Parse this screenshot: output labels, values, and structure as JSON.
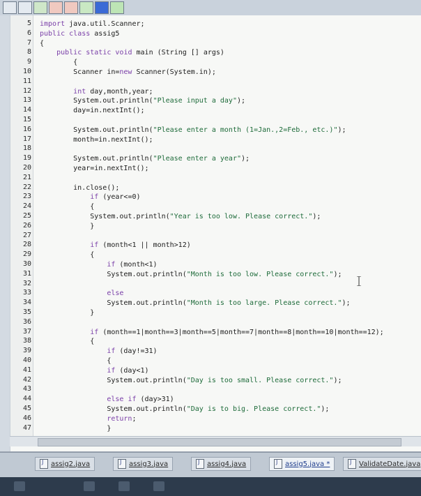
{
  "toolbar": {
    "buttons": [
      "new-file-icon",
      "open-icon",
      "add-icon",
      "bug-icon",
      "debug-icon",
      "run-icon",
      "stop-icon",
      "window-icon"
    ]
  },
  "editor": {
    "lines": [
      {
        "num": "5",
        "text": "import java.util.Scanner;"
      },
      {
        "num": "6",
        "text": "public class assig5"
      },
      {
        "num": "7",
        "text": "{"
      },
      {
        "num": "8",
        "text": "    public static void main (String [] args)"
      },
      {
        "num": "9",
        "text": "        {"
      },
      {
        "num": "10",
        "text": "        Scanner in=new Scanner(System.in);"
      },
      {
        "num": "11",
        "text": ""
      },
      {
        "num": "12",
        "text": "        int day,month,year;"
      },
      {
        "num": "13",
        "text": "        System.out.println(\"Please input a day\");"
      },
      {
        "num": "14",
        "text": "        day=in.nextInt();"
      },
      {
        "num": "15",
        "text": ""
      },
      {
        "num": "16",
        "text": "        System.out.println(\"Please enter a month (1=Jan.,2=Feb., etc.)\");"
      },
      {
        "num": "17",
        "text": "        month=in.nextInt();"
      },
      {
        "num": "18",
        "text": ""
      },
      {
        "num": "19",
        "text": "        System.out.println(\"Please enter a year\");"
      },
      {
        "num": "20",
        "text": "        year=in.nextInt();"
      },
      {
        "num": "21",
        "text": ""
      },
      {
        "num": "22",
        "text": "        in.close();"
      },
      {
        "num": "23",
        "text": "            if (year<=0)"
      },
      {
        "num": "24",
        "text": "            {"
      },
      {
        "num": "25",
        "text": "            System.out.println(\"Year is too low. Please correct.\");"
      },
      {
        "num": "26",
        "text": "            }"
      },
      {
        "num": "27",
        "text": ""
      },
      {
        "num": "28",
        "text": "            if (month<1 || month>12)"
      },
      {
        "num": "29",
        "text": "            {"
      },
      {
        "num": "30",
        "text": "                if (month<1)"
      },
      {
        "num": "31",
        "text": "                System.out.println(\"Month is too low. Please correct.\");"
      },
      {
        "num": "32",
        "text": ""
      },
      {
        "num": "33",
        "text": "                else"
      },
      {
        "num": "34",
        "text": "                System.out.println(\"Month is too large. Please correct.\");"
      },
      {
        "num": "35",
        "text": "            }"
      },
      {
        "num": "36",
        "text": ""
      },
      {
        "num": "37",
        "text": "            if (month==1|month==3|month==5|month==7|month==8|month==10|month==12);"
      },
      {
        "num": "38",
        "text": "            {"
      },
      {
        "num": "39",
        "text": "                if (day!=31)"
      },
      {
        "num": "40",
        "text": "                {"
      },
      {
        "num": "41",
        "text": "                if (day<1)"
      },
      {
        "num": "42",
        "text": "                System.out.println(\"Day is too small. Please correct.\");"
      },
      {
        "num": "43",
        "text": ""
      },
      {
        "num": "44",
        "text": "                else if (day>31)"
      },
      {
        "num": "45",
        "text": "                System.out.println(\"Day is to big. Please correct.\");"
      },
      {
        "num": "46",
        "text": "                return;"
      },
      {
        "num": "47",
        "text": "                }"
      }
    ]
  },
  "tabs": [
    {
      "label": "assig2.java",
      "active": false
    },
    {
      "label": "assig3.java",
      "active": false
    },
    {
      "label": "assig4.java",
      "active": false
    },
    {
      "label": "assig5.java *",
      "active": true
    },
    {
      "label": "ValidateDate.java",
      "active": false
    }
  ],
  "colors": {
    "keyword": "#7a3fa8",
    "string": "#1e6b3a",
    "editor_bg": "#f7f8f6"
  }
}
